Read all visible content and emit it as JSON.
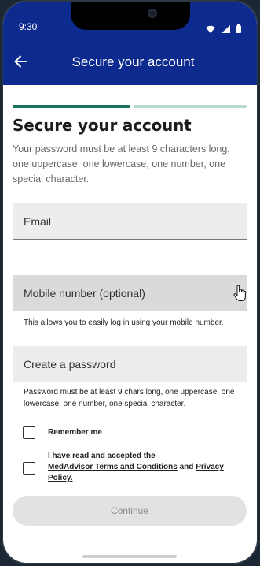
{
  "status_bar": {
    "time": "9:30",
    "icons": [
      "wifi-icon",
      "signal-icon",
      "battery-icon"
    ]
  },
  "app_bar": {
    "title": "Secure your account",
    "back_icon": "arrow-left-icon"
  },
  "colors": {
    "brand": "#0d2a8f",
    "progress_active": "#1d6f5e",
    "progress_inactive": "#b9d8d0"
  },
  "progress": {
    "current_step": 1,
    "total_steps": 2
  },
  "form": {
    "heading": "Secure your account",
    "intro": "Your password must be at least 9 characters long, one uppercase, one lowercase, one number, one special character.",
    "email_label": "Email",
    "mobile_label": "Mobile number (optional)",
    "mobile_hint": "This allows you to easily log in using your mobile number.",
    "password_label": "Create a password",
    "password_hint": "Password must be at least 9 chars long, one uppercase, one lowercase, one number, one special character.",
    "remember_label": "Remember me",
    "remember_checked": false,
    "terms_prefix": "I have read and accepted the",
    "terms_link": "MedAdvisor Terms and Conditions",
    "terms_and": "and",
    "privacy_link": "Privacy Policy.",
    "terms_checked": false,
    "continue_label": "Continue"
  }
}
